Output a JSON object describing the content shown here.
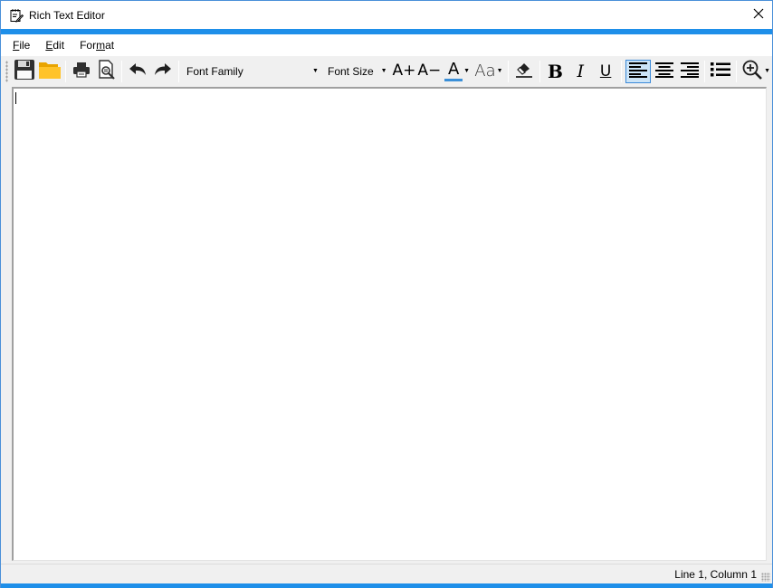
{
  "window": {
    "title": "Rich Text Editor",
    "icons": {
      "app": "notepad-pen-icon",
      "close": "close-icon"
    },
    "accent_color": "#1e8fe9"
  },
  "menu": {
    "items": [
      {
        "label": "File",
        "underline": "F",
        "rest": "ile"
      },
      {
        "label": "Edit",
        "underline": "E",
        "rest": "dit"
      },
      {
        "label": "Format",
        "prefix": "For",
        "underline": "m",
        "rest": "at"
      }
    ]
  },
  "toolbar": {
    "font_family_placeholder": "Font Family",
    "font_size_placeholder": "Font Size",
    "grow_font_label": "A+",
    "shrink_font_label": "A−",
    "font_color_label": "A",
    "change_case_label": "Aa",
    "bold_label": "B",
    "italic_label": "I",
    "underline_label": "U",
    "icons": [
      "save-icon",
      "open-folder-icon",
      "print-icon",
      "print-preview-icon",
      "undo-icon",
      "redo-icon",
      "grow-font-icon",
      "shrink-font-icon",
      "font-color-icon",
      "change-case-icon",
      "eraser-icon",
      "bold-icon",
      "italic-icon",
      "underline-icon",
      "align-left-icon",
      "align-center-icon",
      "align-right-icon",
      "bullet-list-icon",
      "zoom-in-icon"
    ],
    "active_alignment": "left",
    "font_color_underline": "#3a8fd8"
  },
  "editor": {
    "content": ""
  },
  "status": {
    "position_text": "Line 1, Column 1"
  }
}
